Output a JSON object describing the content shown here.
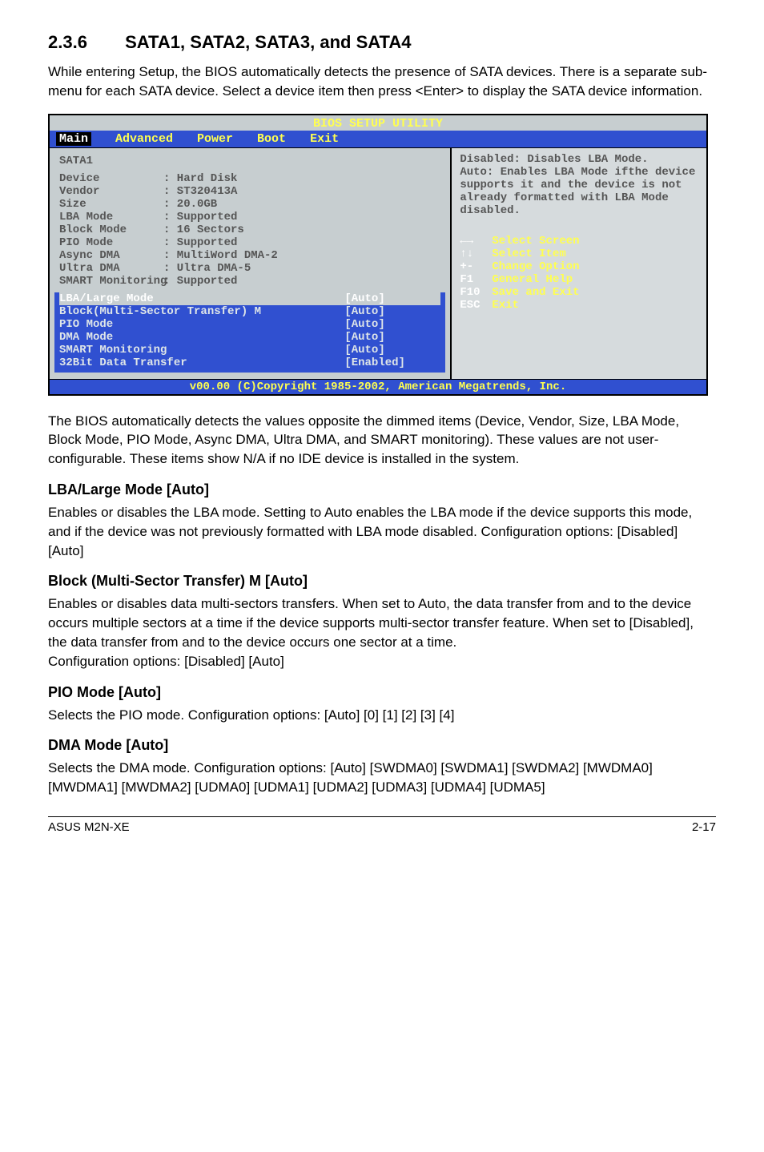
{
  "section_number": "2.3.6",
  "section_title": "SATA1, SATA2, SATA3, and SATA4",
  "intro_p": "While entering Setup, the BIOS automatically detects the presence of SATA devices. There is a separate sub-menu for each SATA device. Select a device item then press <Enter> to display the SATA device information.",
  "bios": {
    "utility_title": "BIOS SETUP UTILITY",
    "menu": {
      "main": "Main",
      "advanced": "Advanced",
      "power": "Power",
      "boot": "Boot",
      "exit": "Exit"
    },
    "panel_title": "SATA1",
    "device_info": [
      {
        "label": "Device",
        "value": ": Hard Disk"
      },
      {
        "label": "Vendor",
        "value": ": ST320413A"
      },
      {
        "label": "Size",
        "value": ": 20.0GB"
      },
      {
        "label": "LBA Mode",
        "value": ": Supported"
      },
      {
        "label": "Block Mode",
        "value": ": 16 Sectors"
      },
      {
        "label": "PIO Mode",
        "value": ": Supported"
      },
      {
        "label": "Async DMA",
        "value": ": MultiWord DMA-2"
      },
      {
        "label": "Ultra DMA",
        "value": ": Ultra DMA-5"
      },
      {
        "label": "SMART Monitoring",
        "value": ": Supported"
      }
    ],
    "options": [
      {
        "label": "LBA/Large Mode",
        "value": "[Auto]",
        "selected": true
      },
      {
        "label": "Block(Multi-Sector Transfer) M",
        "value": "[Auto]"
      },
      {
        "label": "PIO Mode",
        "value": "[Auto]"
      },
      {
        "label": "DMA Mode",
        "value": "[Auto]"
      },
      {
        "label": "SMART Monitoring",
        "value": "[Auto]"
      },
      {
        "label": "32Bit Data Transfer",
        "value": "[Enabled]"
      }
    ],
    "help_text": "Disabled: Disables LBA Mode.\nAuto: Enables LBA Mode ifthe device supports it and the device is not already formatted with LBA Mode disabled.",
    "keys": [
      {
        "k": "←→",
        "t": "Select Screen"
      },
      {
        "k": "↑↓",
        "t": "Select Item"
      },
      {
        "k": "+-",
        "t": "Change Option"
      },
      {
        "k": "F1",
        "t": "General Help"
      },
      {
        "k": "F10",
        "t": "Save and Exit"
      },
      {
        "k": "ESC",
        "t": "Exit"
      }
    ],
    "footer": "v00.00 (C)Copyright 1985-2002, American Megatrends, Inc."
  },
  "after_bios_p": "The BIOS automatically detects the values opposite the dimmed items (Device, Vendor, Size, LBA Mode, Block Mode, PIO Mode, Async DMA, Ultra DMA, and SMART monitoring). These values are not user-configurable. These items show N/A if no IDE device is installed in the system.",
  "sections": {
    "lba": {
      "title": "LBA/Large Mode [Auto]",
      "body": "Enables or disables the LBA mode. Setting to Auto enables the LBA mode if the device supports this mode, and if the device was not previously formatted with LBA mode disabled. Configuration options: [Disabled] [Auto]"
    },
    "block": {
      "title": "Block (Multi-Sector Transfer) M [Auto]",
      "body": "Enables or disables data multi-sectors transfers. When set to Auto, the data transfer from and to the device occurs multiple sectors at a time if the device supports multi-sector transfer feature. When set to [Disabled], the data transfer from and to the device occurs one sector at a time.\nConfiguration options: [Disabled] [Auto]"
    },
    "pio": {
      "title": "PIO Mode [Auto]",
      "body": "Selects the PIO mode. Configuration options: [Auto] [0] [1] [2] [3] [4]"
    },
    "dma": {
      "title": "DMA Mode [Auto]",
      "body": "Selects the DMA mode. Configuration options: [Auto] [SWDMA0] [SWDMA1] [SWDMA2] [MWDMA0] [MWDMA1] [MWDMA2] [UDMA0] [UDMA1] [UDMA2] [UDMA3] [UDMA4] [UDMA5]"
    }
  },
  "footer_left": "ASUS M2N-XE",
  "footer_right": "2-17"
}
